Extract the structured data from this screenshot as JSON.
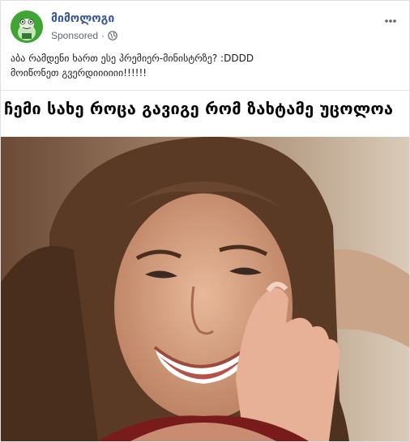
{
  "post": {
    "page_name": "მიმოლოგი",
    "sponsored_label": "Sponsored",
    "caption_lines": [
      "აბა რამდენი ხართ ესე პრემიერ-მინისტრზე? :DDDD",
      "მოიწონეთ გვერდიიიიიი!!!!!!"
    ],
    "meme_title": "ჩემი სახე როცა გავიგე რომ ზახტამე უცოლოა"
  },
  "icons": {
    "avatar": "page-avatar-frog",
    "privacy": "globe-icon",
    "menu": "more-options-icon"
  },
  "colors": {
    "page_name": "#385898",
    "meta_text": "#616770",
    "avatar_bg": "#3fa535"
  }
}
